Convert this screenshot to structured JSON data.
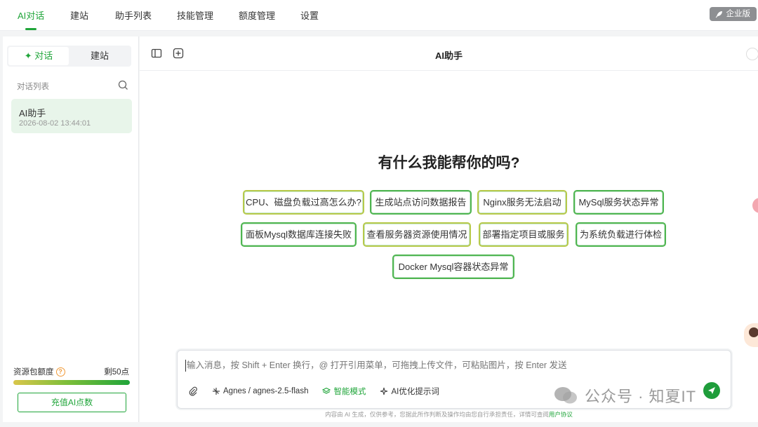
{
  "nav": {
    "items": [
      "AI对话",
      "建站",
      "助手列表",
      "技能管理",
      "额度管理",
      "设置"
    ],
    "badge": "企业版"
  },
  "sidebar": {
    "tab_chat": "对话",
    "tab_site": "建站",
    "list_header": "对话列表",
    "chats": [
      {
        "title": "AI助手",
        "time": "2026-08-02 13:44:01"
      }
    ],
    "quota_label": "资源包额度",
    "quota_remaining": "剩50点",
    "quota_fraction": 1.0,
    "recharge": "充值AI点数"
  },
  "main": {
    "title": "AI助手",
    "welcome": "有什么我能帮你的吗?",
    "suggestions": [
      "CPU、磁盘负载过高怎么办?",
      "生成站点访问数据报告",
      "Nginx服务无法启动",
      "MySql服务状态异常",
      "面板Mysql数据库连接失败",
      "查看服务器资源使用情况",
      "部署指定项目或服务",
      "为系统负载进行体检",
      "Docker Mysql容器状态异常"
    ],
    "input_placeholder": "输入消息，按 Shift + Enter 换行，@ 打开引用菜单，可拖拽上传文件，可粘贴图片，按 Enter 发送",
    "model": "Agnes / agnes-2.5-flash",
    "mode": "智能模式",
    "optimize": "AI优化提示词",
    "disclaimer": "内容由 AI 生成，仅供参考，您据此所作判断及操作均由您自行承担责任，详情可查阅",
    "disclaimer_link": "用户协议"
  },
  "watermark": "公众号 · 知夏IT",
  "colors": {
    "accent": "#20a53a",
    "chip_border": "#b7c94a"
  }
}
